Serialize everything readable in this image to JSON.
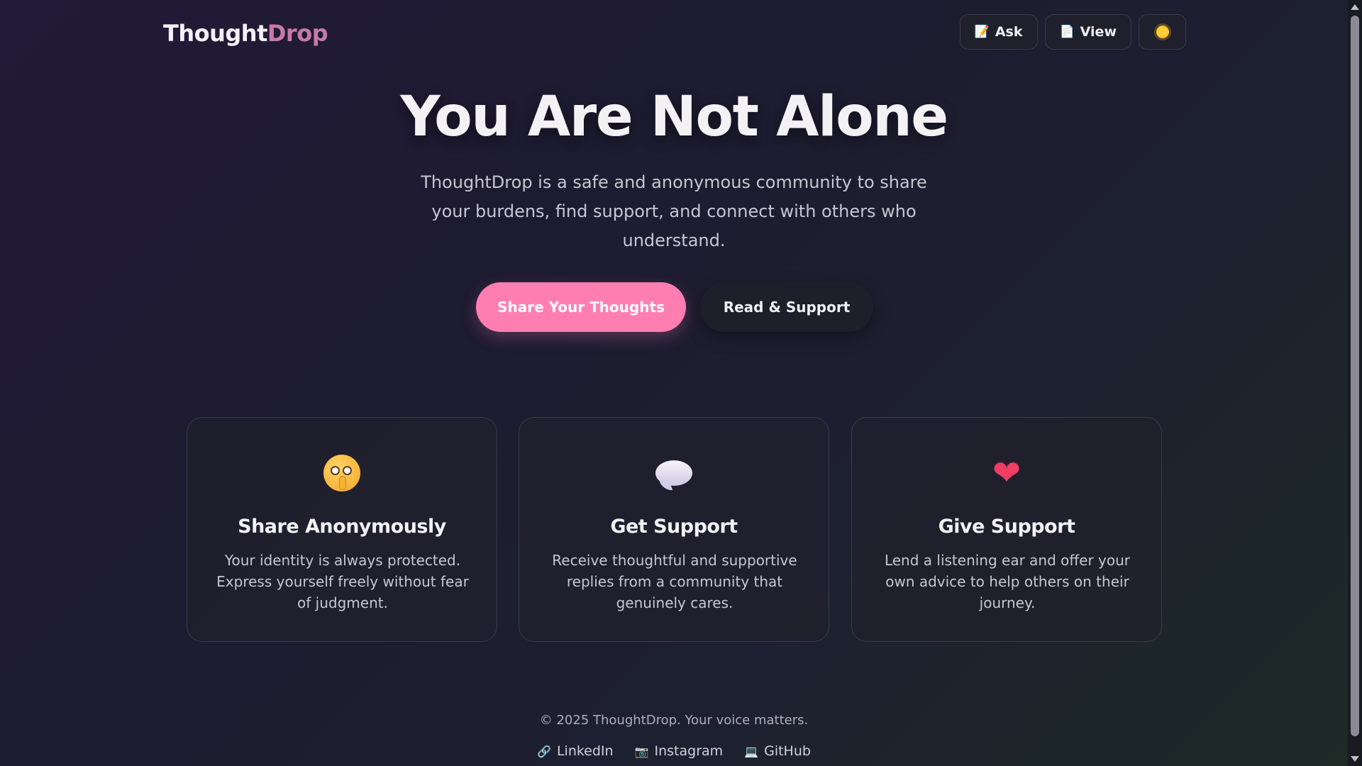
{
  "header": {
    "logo_part1": "Thought",
    "logo_part2": "Drop",
    "nav": [
      {
        "label": "Ask",
        "icon": "memo-icon"
      },
      {
        "label": "View",
        "icon": "document-icon"
      },
      {
        "label": "",
        "icon": "sun-icon"
      }
    ]
  },
  "hero": {
    "title": "You Are Not Alone",
    "subtitle": "ThoughtDrop is a safe and anonymous community to share your burdens, find support, and connect with others who understand.",
    "primary_cta": "Share Your Thoughts",
    "secondary_cta": "Read & Support"
  },
  "features": [
    {
      "title": "Share Anonymously",
      "description": "Your identity is always protected. Express yourself freely without fear of judgment.",
      "icon": "shushing-face-icon"
    },
    {
      "title": "Get Support",
      "description": "Receive thoughtful and supportive replies from a community that genuinely cares.",
      "icon": "speech-bubble-icon"
    },
    {
      "title": "Give Support",
      "description": "Lend a listening ear and offer your own advice to help others on their journey.",
      "icon": "heart-icon"
    }
  ],
  "footer": {
    "copyright": "© 2025 ThoughtDrop. Your voice matters.",
    "links": [
      {
        "label": "LinkedIn",
        "icon": "link-icon"
      },
      {
        "label": "Instagram",
        "icon": "camera-icon"
      },
      {
        "label": "GitHub",
        "icon": "laptop-icon"
      }
    ]
  },
  "colors": {
    "accent_pink": "#ff7eb1",
    "logo_accent": "#c77aa6",
    "card_bg": "#20202c"
  }
}
